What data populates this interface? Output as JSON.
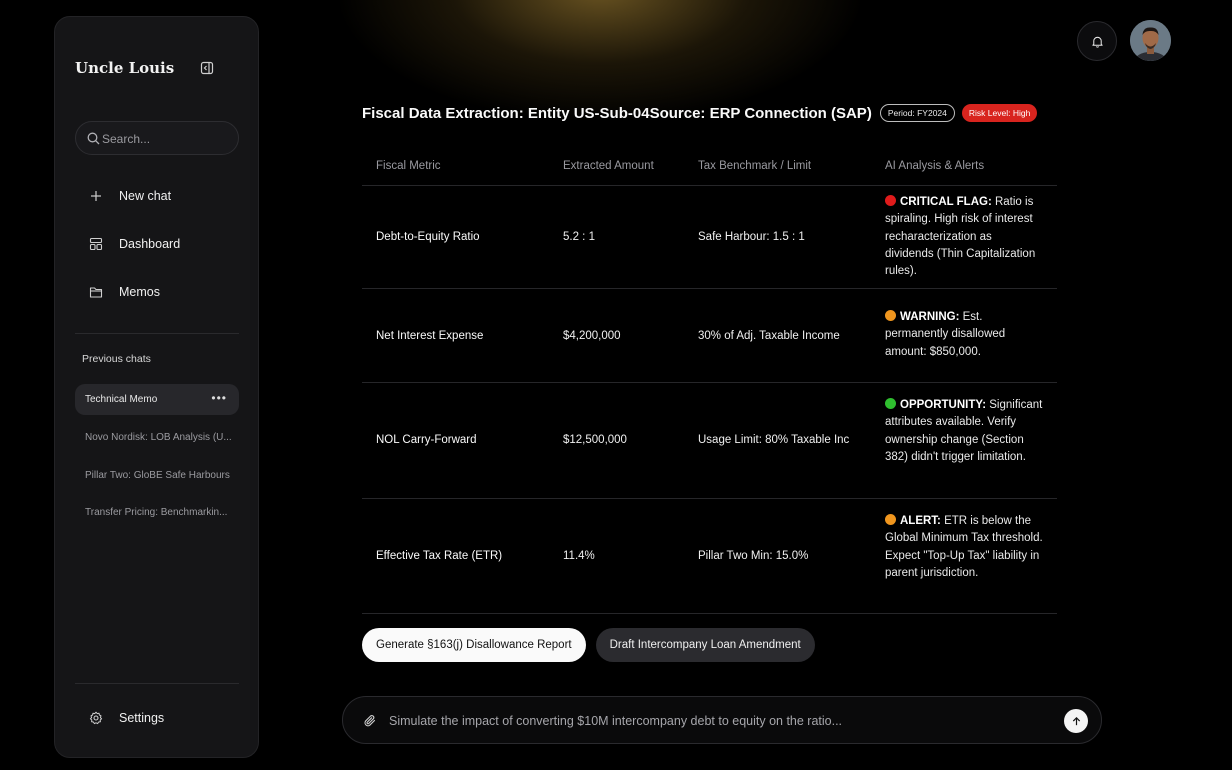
{
  "sidebar": {
    "brand": "Uncle Louis",
    "search_placeholder": "Search...",
    "nav": [
      {
        "label": "New chat",
        "icon": "plus-icon"
      },
      {
        "label": "Dashboard",
        "icon": "dashboard-icon"
      },
      {
        "label": "Memos",
        "icon": "folder-icon"
      }
    ],
    "previous_chats_title": "Previous chats",
    "chats": [
      {
        "label": "Technical Memo",
        "active": true
      },
      {
        "label": "Novo Nordisk: LOB Analysis (U..."
      },
      {
        "label": "Pillar Two: GloBE Safe Harbours"
      },
      {
        "label": "Transfer Pricing: Benchmarkin..."
      }
    ],
    "settings_label": "Settings"
  },
  "header": {
    "title": "Fiscal Data Extraction: Entity US-Sub-04Source: ERP Connection (SAP)",
    "period_badge": "Period: FY2024",
    "risk_badge": "Risk Level: High",
    "risk_color": "#d8241e"
  },
  "table": {
    "columns": [
      "Fiscal Metric",
      "Extracted Amount",
      "Tax Benchmark / Limit",
      "AI Analysis & Alerts"
    ],
    "rows": [
      {
        "metric": "Debt-to-Equity Ratio",
        "amount": "5.2 : 1",
        "benchmark": "Safe Harbour: 1.5 : 1",
        "alert_color": "#e01b1b",
        "alert_label": "CRITICAL FLAG:",
        "alert_text": " Ratio is spiraling. High risk of interest recharacterization as dividends (Thin Capitalization rules)."
      },
      {
        "metric": "Net Interest Expense",
        "amount": "$4,200,000",
        "benchmark": "30% of Adj. Taxable Income",
        "alert_color": "#f0961e",
        "alert_label": "WARNING:",
        "alert_text": " Est. permanently disallowed amount: $850,000."
      },
      {
        "metric": "NOL Carry-Forward",
        "amount": "$12,500,000",
        "benchmark": "Usage Limit: 80% Taxable Inc",
        "alert_color": "#2fbf2f",
        "alert_label": "OPPORTUNITY:",
        "alert_text": " Significant attributes available. Verify ownership change (Section 382) didn't trigger limitation."
      },
      {
        "metric": "Effective Tax Rate (ETR)",
        "amount": "11.4%",
        "benchmark": "Pillar Two Min: 15.0%",
        "alert_color": "#f0961e",
        "alert_label": "ALERT:",
        "alert_text": " ETR is below the Global Minimum Tax threshold. Expect \"Top-Up Tax\" liability in parent jurisdiction."
      }
    ]
  },
  "actions": {
    "primary": "Generate §163(j) Disallowance Report",
    "secondary": "Draft Intercompany Loan Amendment"
  },
  "composer": {
    "placeholder": "Simulate the impact of converting $10M intercompany debt to equity on the ratio..."
  }
}
